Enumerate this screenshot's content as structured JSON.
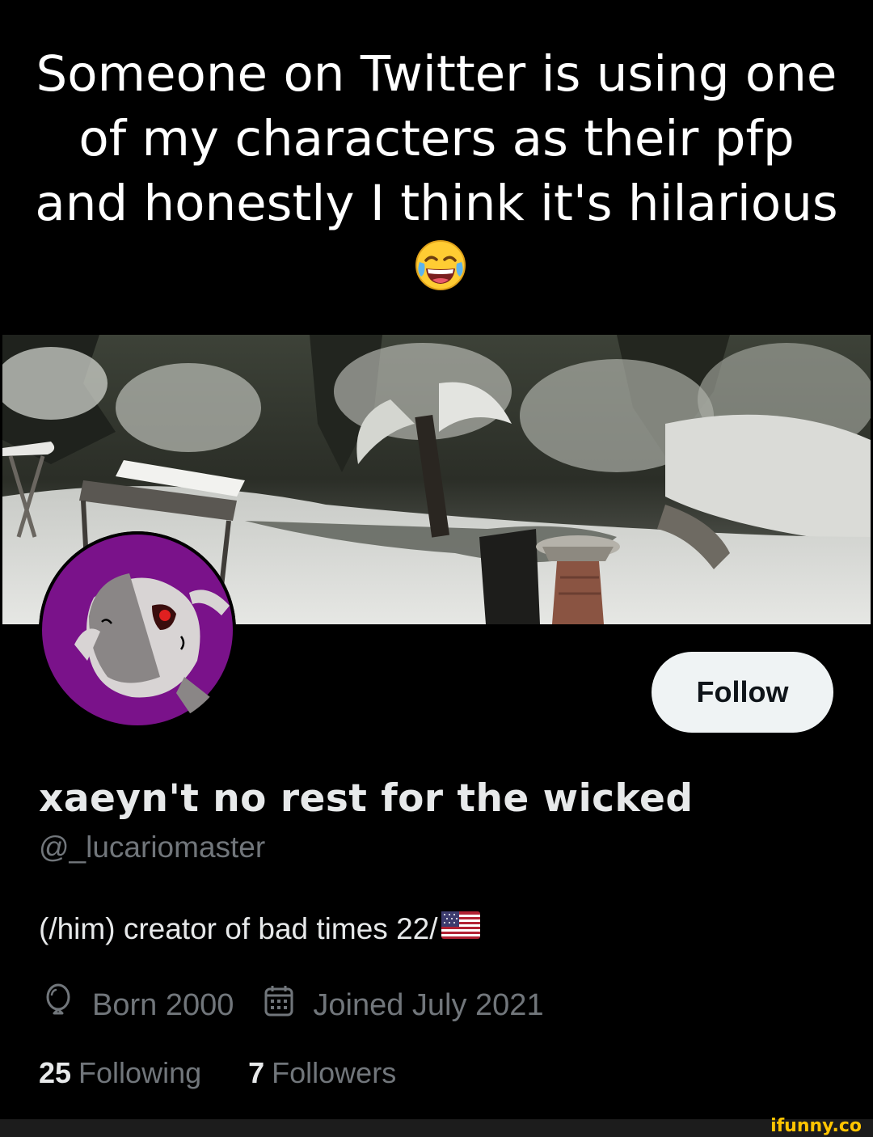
{
  "meme": {
    "caption": "Someone on Twitter is using one of my characters as their pfp and honestly I think it's hilarious",
    "emoji_icon": "face-with-tears-of-joy-icon"
  },
  "profile": {
    "follow_label": "Follow",
    "display_name": "xaeyn't no rest for the wicked",
    "handle": "@_lucariomaster",
    "bio": "(/him) creator of bad times 22/",
    "bio_flag_icon": "us-flag-icon",
    "birthday": "Born 2000",
    "joined": "Joined July 2021",
    "following_count": "25",
    "following_label": "Following",
    "followers_count": "7",
    "followers_label": "Followers"
  },
  "watermark": "ifunny.co",
  "colors": {
    "background": "#000000",
    "avatar_bg": "#7a128a",
    "follow_button_bg": "#eff3f4",
    "secondary_text": "#71767b",
    "watermark": "#ffc400"
  }
}
